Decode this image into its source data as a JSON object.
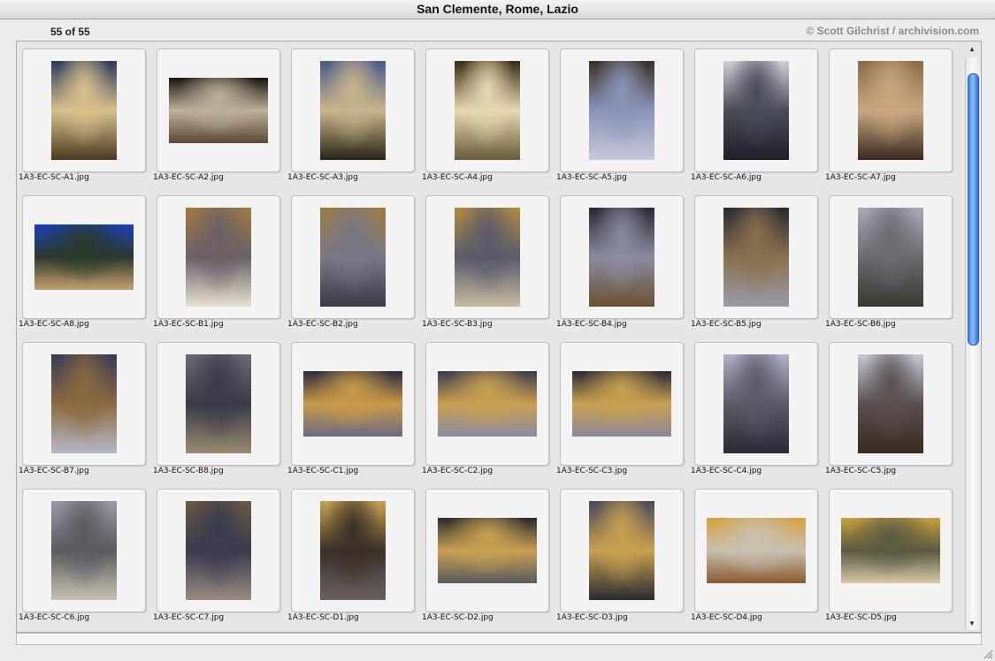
{
  "window": {
    "title": "San Clemente, Rome, Lazio"
  },
  "info": {
    "count": "55 of 55",
    "credit": "© Scott Gilchrist / archivision.com"
  },
  "slides": [
    {
      "file": "1A3-EC-SC-A1.jpg",
      "orientation": "portrait",
      "colors": [
        "#2b3a5e",
        "#d8c08c",
        "#4a3a22"
      ]
    },
    {
      "file": "1A3-EC-SC-A2.jpg",
      "orientation": "landscape",
      "colors": [
        "#1a1510",
        "#bdb09a",
        "#5a4a36"
      ]
    },
    {
      "file": "1A3-EC-SC-A3.jpg",
      "orientation": "portrait",
      "colors": [
        "#4a5b8a",
        "#c8b48a",
        "#2a2418"
      ]
    },
    {
      "file": "1A3-EC-SC-A4.jpg",
      "orientation": "portrait",
      "colors": [
        "#3a2a14",
        "#e6d8b0",
        "#6a5a3a"
      ]
    },
    {
      "file": "1A3-EC-SC-A5.jpg",
      "orientation": "portrait",
      "colors": [
        "#3a3024",
        "#8a94b8",
        "#c8c8d8"
      ]
    },
    {
      "file": "1A3-EC-SC-A6.jpg",
      "orientation": "portrait",
      "colors": [
        "#cfcfd8",
        "#4a4c58",
        "#1e1e28"
      ]
    },
    {
      "file": "1A3-EC-SC-A7.jpg",
      "orientation": "portrait",
      "colors": [
        "#8a6a48",
        "#c9a680",
        "#3a2a1e"
      ]
    },
    {
      "file": "1A3-EC-SC-A8.jpg",
      "orientation": "landscape",
      "colors": [
        "#1c3fb8",
        "#2a3a2a",
        "#c8a070"
      ]
    },
    {
      "file": "1A3-EC-SC-B1.jpg",
      "orientation": "portrait",
      "colors": [
        "#a07a40",
        "#6a6068",
        "#e8e0d0"
      ]
    },
    {
      "file": "1A3-EC-SC-B2.jpg",
      "orientation": "portrait",
      "colors": [
        "#9a7a40",
        "#7a7888",
        "#3a3a48"
      ]
    },
    {
      "file": "1A3-EC-SC-B3.jpg",
      "orientation": "portrait",
      "colors": [
        "#b08a40",
        "#5a5a6a",
        "#c8b8a0"
      ]
    },
    {
      "file": "1A3-EC-SC-B4.jpg",
      "orientation": "portrait",
      "colors": [
        "#2a2a34",
        "#8a8aa0",
        "#6a5030"
      ]
    },
    {
      "file": "1A3-EC-SC-B5.jpg",
      "orientation": "portrait",
      "colors": [
        "#2a2a30",
        "#8a7050",
        "#9a9aa8"
      ]
    },
    {
      "file": "1A3-EC-SC-B6.jpg",
      "orientation": "portrait",
      "colors": [
        "#a8a8b8",
        "#6a6a70",
        "#3a3830"
      ]
    },
    {
      "file": "1A3-EC-SC-B7.jpg",
      "orientation": "portrait",
      "colors": [
        "#3a3a58",
        "#8a6a40",
        "#b8b8c8"
      ]
    },
    {
      "file": "1A3-EC-SC-B8.jpg",
      "orientation": "portrait",
      "colors": [
        "#6a6a78",
        "#3a3a48",
        "#9a8a70"
      ]
    },
    {
      "file": "1A3-EC-SC-C1.jpg",
      "orientation": "landscape",
      "colors": [
        "#2a2a40",
        "#c89a48",
        "#6a6a80"
      ]
    },
    {
      "file": "1A3-EC-SC-C2.jpg",
      "orientation": "landscape",
      "colors": [
        "#3a3a50",
        "#c8a050",
        "#8a8aa0"
      ]
    },
    {
      "file": "1A3-EC-SC-C3.jpg",
      "orientation": "landscape",
      "colors": [
        "#2a2a38",
        "#c8a050",
        "#8a8898"
      ]
    },
    {
      "file": "1A3-EC-SC-C4.jpg",
      "orientation": "portrait",
      "colors": [
        "#b0b0c8",
        "#5a5a68",
        "#2a2a38"
      ]
    },
    {
      "file": "1A3-EC-SC-C5.jpg",
      "orientation": "portrait",
      "colors": [
        "#c8c8d8",
        "#5a5050",
        "#3a2a20"
      ]
    },
    {
      "file": "1A3-EC-SC-C6.jpg",
      "orientation": "portrait",
      "colors": [
        "#9a9aa8",
        "#5a5a60",
        "#c8c0b0"
      ]
    },
    {
      "file": "1A3-EC-SC-C7.jpg",
      "orientation": "portrait",
      "colors": [
        "#6a5a40",
        "#3a3a50",
        "#9a8a80"
      ]
    },
    {
      "file": "1A3-EC-SC-D1.jpg",
      "orientation": "portrait",
      "colors": [
        "#c8a050",
        "#3a3028",
        "#6a6060"
      ]
    },
    {
      "file": "1A3-EC-SC-D2.jpg",
      "orientation": "landscape",
      "colors": [
        "#2a2a30",
        "#c8a050",
        "#5a5a60"
      ]
    },
    {
      "file": "1A3-EC-SC-D3.jpg",
      "orientation": "portrait",
      "colors": [
        "#4a4a58",
        "#c8a050",
        "#2a2a30"
      ]
    },
    {
      "file": "1A3-EC-SC-D4.jpg",
      "orientation": "landscape",
      "colors": [
        "#d8a040",
        "#c8c0b0",
        "#8a5a30"
      ]
    },
    {
      "file": "1A3-EC-SC-D5.jpg",
      "orientation": "landscape",
      "colors": [
        "#c8a040",
        "#5a5a40",
        "#d8c8a8"
      ]
    }
  ],
  "accent": "#3d7fe0"
}
